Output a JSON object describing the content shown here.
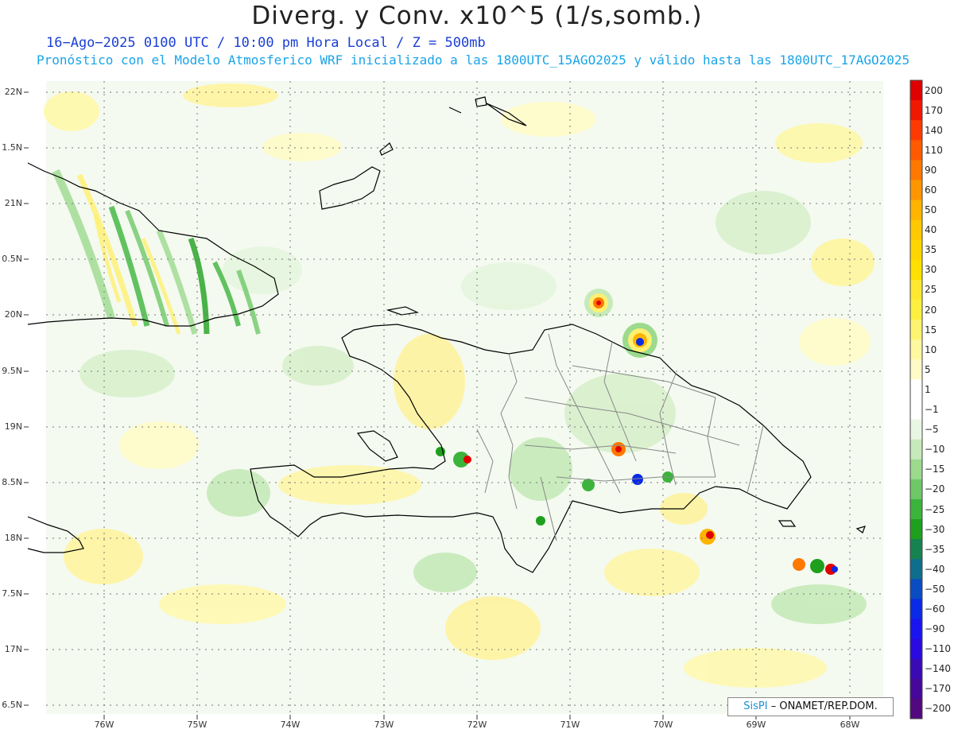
{
  "title": "Diverg. y Conv. x10^5 (1/s,somb.)",
  "subtitle_line1": "16−Ago−2025  0100 UTC / 10:00 pm Hora Local / Z = 500mb",
  "subtitle_line2": "Pronóstico con el Modelo Atmosferico WRF inicializado a las 1800UTC_15AGO2025 y válido hasta las  1800UTC_17AGO2025",
  "credit": {
    "brand": "SisPI",
    "rest": " –  ONAMET/REP.DOM."
  },
  "lat_labels": [
    "22N",
    "1.5N",
    "21N",
    "0.5N",
    "20N",
    "9.5N",
    "19N",
    "8.5N",
    "18N",
    "7.5N",
    "17N",
    "6.5N"
  ],
  "lon_labels": [
    "76W",
    "75W",
    "74W",
    "73W",
    "72W",
    "71W",
    "70W",
    "69W",
    "68W"
  ],
  "legend": {
    "labels": [
      "200",
      "170",
      "140",
      "110",
      "90",
      "60",
      "50",
      "40",
      "35",
      "30",
      "25",
      "20",
      "15",
      "10",
      "5",
      "1",
      "−1",
      "−5",
      "−10",
      "−15",
      "−20",
      "−25",
      "−30",
      "−35",
      "−40",
      "−50",
      "−60",
      "−90",
      "−110",
      "−140",
      "−170",
      "−200"
    ],
    "colors": [
      "#e00000",
      "#f01800",
      "#ff3a00",
      "#ff5a00",
      "#ff7800",
      "#ff9600",
      "#ffb400",
      "#ffc800",
      "#ffd600",
      "#ffe000",
      "#ffe830",
      "#fff040",
      "#fff470",
      "#fff8a0",
      "#fffbc8",
      "#ffffff",
      "#ffffff",
      "#eaf6e4",
      "#c6eab9",
      "#9cda8e",
      "#6ec867",
      "#3cb43c",
      "#1ea01e",
      "#168250",
      "#0e6e8c",
      "#0a4cc2",
      "#0a2ae6",
      "#1a14f0",
      "#2a0ae0",
      "#3a0ab4",
      "#46089a",
      "#52087e"
    ]
  }
}
